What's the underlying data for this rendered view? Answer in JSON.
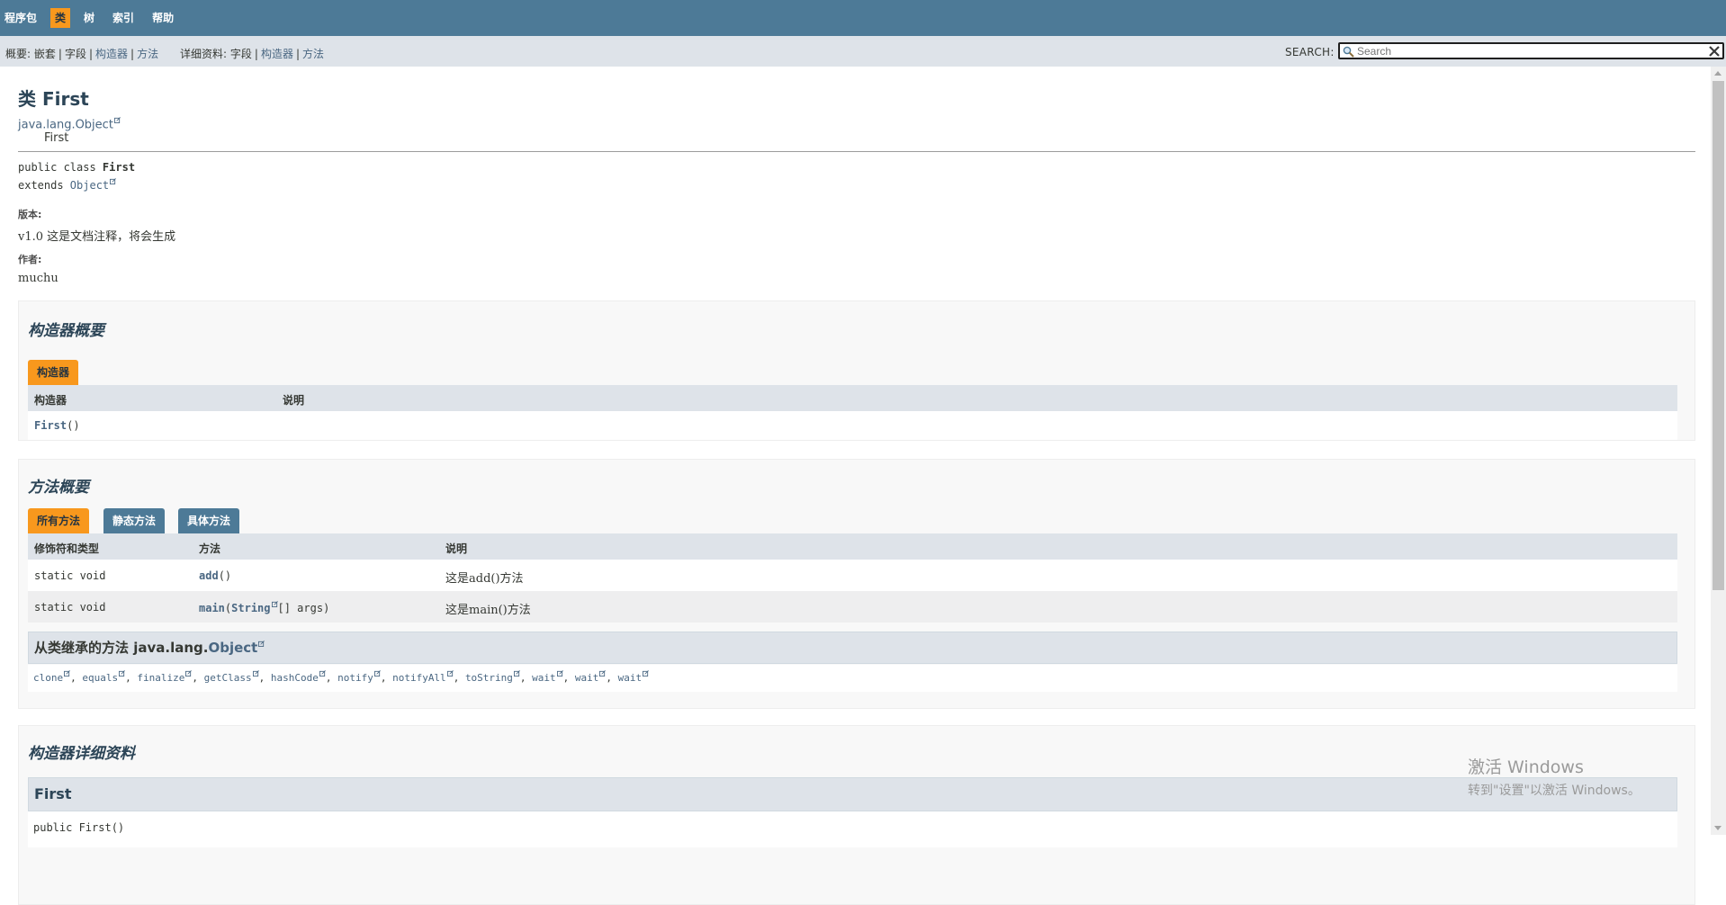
{
  "topnav": {
    "items": [
      {
        "label": "程序包"
      },
      {
        "label": "类",
        "active": true
      },
      {
        "label": "树"
      },
      {
        "label": "索引"
      },
      {
        "label": "帮助"
      }
    ]
  },
  "subnav": {
    "summary_label": "概要:",
    "summary_nested": "嵌套",
    "summary_field": "字段",
    "summary_constructor": "构造器",
    "summary_method": "方法",
    "detail_label": "详细资料:",
    "detail_field": "字段",
    "detail_constructor": "构造器",
    "detail_method": "方法",
    "sep": "|",
    "search_label": "SEARCH:",
    "search_placeholder": "Search",
    "search_value": ""
  },
  "header": {
    "title": "类 First",
    "inherit_parent": "java.lang.Object",
    "inherit_child": "First"
  },
  "signature": {
    "line1_prefix": "public class ",
    "line1_name": "First",
    "line2_prefix": "extends ",
    "line2_link": "Object"
  },
  "meta": {
    "version_label": "版本:",
    "version_value": "v1.0 这是文档注释，将会生成",
    "author_label": "作者:",
    "author_value": "muchu"
  },
  "constructor_summary": {
    "title": "构造器概要",
    "tab": "构造器",
    "col1": "构造器",
    "col2": "说明",
    "rows": [
      {
        "name": "First",
        "params": "()",
        "desc": ""
      }
    ]
  },
  "method_summary": {
    "title": "方法概要",
    "tabs": [
      {
        "label": "所有方法",
        "active": true
      },
      {
        "label": "静态方法"
      },
      {
        "label": "具体方法"
      }
    ],
    "col1": "修饰符和类型",
    "col2": "方法",
    "col3": "说明",
    "rows": [
      {
        "modifier": "static void",
        "name": "add",
        "params_open": "()",
        "params_type": "",
        "params_rest": "",
        "desc": "这是add()方法"
      },
      {
        "modifier": "static void",
        "name": "main",
        "params_open": "(",
        "params_type": "String",
        "params_rest": "[]  args)",
        "desc": "这是main()方法"
      }
    ],
    "inherited_prefix": "从类继承的方法 java.lang.",
    "inherited_class": "Object",
    "inherited_methods": [
      "clone",
      "equals",
      "finalize",
      "getClass",
      "hashCode",
      "notify",
      "notifyAll",
      "toString",
      "wait",
      "wait",
      "wait"
    ]
  },
  "constructor_detail": {
    "title": "构造器详细资料",
    "item_name": "First",
    "item_signature": "public  First()"
  },
  "watermark": {
    "line1": "激活 Windows",
    "line2": "转到\"设置\"以激活 Windows。"
  },
  "colors": {
    "nav_bg": "#4d7a97",
    "active_tab": "#f8981d",
    "subnav_bg": "#dee3e9",
    "link": "#4a6782"
  }
}
